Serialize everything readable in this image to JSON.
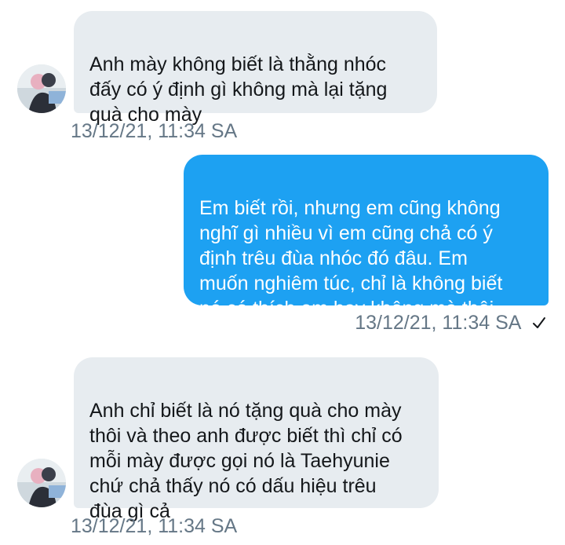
{
  "conversation": {
    "messages": [
      {
        "direction": "received",
        "text": "Anh mày không biết là thằng nhóc\nđấy có ý định gì không mà lại tặng\nquà cho mày",
        "timestamp": "13/12/21, 11:34 SA"
      },
      {
        "direction": "sent",
        "text": "Em biết rồi, nhưng em cũng không\nnghĩ gì nhiều vì em cũng chả có ý\nđịnh trêu đùa nhóc đó đâu. Em\nmuốn nghiêm túc, chỉ là không biết\nnó có thích em hay không mà thôi",
        "timestamp": "13/12/21, 11:34 SA",
        "status_icon": "checkmark-icon"
      },
      {
        "direction": "received",
        "text": "Anh chỉ biết là nó tặng quà cho mày\nthôi và theo anh được biết thì chỉ có\nmỗi mày được gọi nó là Taehyunie\nchứ chả thấy nó có dấu hiệu trêu\nđùa gì cả",
        "timestamp": "13/12/21, 11:34 SA"
      }
    ]
  },
  "colors": {
    "sent_bubble": "#1da1f2",
    "received_bubble": "#e7ecf0",
    "timestamp_text": "#657786"
  }
}
